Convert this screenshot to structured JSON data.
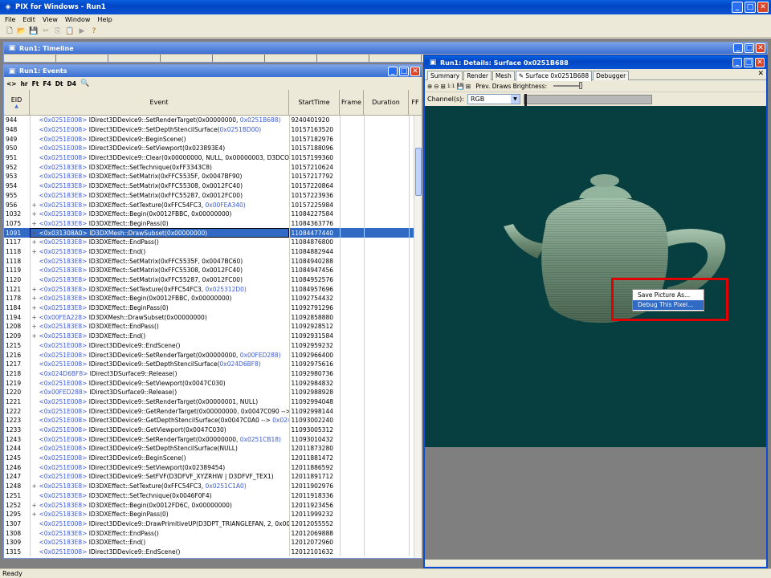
{
  "app": {
    "title": "PIX for Windows - Run1"
  },
  "menu": [
    "File",
    "Edit",
    "View",
    "Window",
    "Help"
  ],
  "timeline": {
    "title": "Run1: Timeline"
  },
  "events": {
    "title": "Run1: Events",
    "toolbar": [
      "hr",
      "Ft",
      "F4",
      "Dt",
      "D4"
    ],
    "columns": [
      "EID",
      "Event",
      "StartTime",
      "Frame",
      "Duration",
      "FF"
    ],
    "rows": [
      {
        "eid": "944",
        "expand": "",
        "addr": "<0x0251E008>",
        "event": " IDirect3DDevice9::SetRenderTarget(0x00000000, ",
        "tail": "0x0251B688)",
        "time": "9240401920"
      },
      {
        "eid": "948",
        "expand": "",
        "addr": "<0x0251E008>",
        "event": " IDirect3DDevice9::SetDepthStencilSurface(",
        "tail": "0x0251BD00)",
        "time": "10157163520"
      },
      {
        "eid": "949",
        "expand": "",
        "addr": "<0x0251E008>",
        "event": " IDirect3DDevice9::BeginScene()",
        "tail": "",
        "time": "10157182976"
      },
      {
        "eid": "950",
        "expand": "",
        "addr": "<0x0251E008>",
        "event": " IDirect3DDevice9::SetViewport(0x023893E4)",
        "tail": "",
        "time": "10157188096"
      },
      {
        "eid": "951",
        "expand": "",
        "addr": "<0x0251E008>",
        "event": " IDirect3DDevice9::Clear(0x00000000, NULL, 0x00000003, D3DCOLOR",
        "tail": "",
        "time": "10157199360"
      },
      {
        "eid": "952",
        "expand": "",
        "addr": "<0x025183E8>",
        "event": " ID3DXEffect::SetTechnique(0xFF3343C8)",
        "tail": "",
        "time": "10157210624"
      },
      {
        "eid": "953",
        "expand": "",
        "addr": "<0x025183E8>",
        "event": " ID3DXEffect::SetMatrix(0xFFC5535F, 0x0047BF90)",
        "tail": "",
        "time": "10157217792"
      },
      {
        "eid": "954",
        "expand": "",
        "addr": "<0x025183E8>",
        "event": " ID3DXEffect::SetMatrix(0xFFC55308, 0x0012FC40)",
        "tail": "",
        "time": "10157220864"
      },
      {
        "eid": "955",
        "expand": "",
        "addr": "<0x025183E8>",
        "event": " ID3DXEffect::SetMatrix(0xFFC55287, 0x0012FC00)",
        "tail": "",
        "time": "10157223936"
      },
      {
        "eid": "956",
        "expand": "+",
        "addr": "<0x025183E8>",
        "event": " ID3DXEffect::SetTexture(0xFFC54FC3, ",
        "tail": "0x00FEA340)",
        "time": "10157225984"
      },
      {
        "eid": "1032",
        "expand": "+",
        "addr": "<0x025183E8>",
        "event": " ID3DXEffect::Begin(0x0012FBBC, 0x00000000)",
        "tail": "",
        "time": "11084227584"
      },
      {
        "eid": "1075",
        "expand": "+",
        "addr": "<0x025183E8>",
        "event": " ID3DXEffect::BeginPass(0)",
        "tail": "",
        "time": "11084363776"
      },
      {
        "eid": "1091",
        "expand": "+",
        "addr": "<0x031308A0>",
        "event": " ID3DXMesh::DrawSubset(0x00000000)",
        "tail": "",
        "time": "11084477440",
        "selected": true
      },
      {
        "eid": "1117",
        "expand": "+",
        "addr": "<0x025183E8>",
        "event": " ID3DXEffect::EndPass()",
        "tail": "",
        "time": "11084876800"
      },
      {
        "eid": "1118",
        "expand": "+",
        "addr": "<0x025183E8>",
        "event": " ID3DXEffect::End()",
        "tail": "",
        "time": "11084882944"
      },
      {
        "eid": "1118",
        "expand": "",
        "addr": "<0x025183E8>",
        "event": " ID3DXEffect::SetMatrix(0xFFC5535F, 0x0047BC60)",
        "tail": "",
        "time": "11084940288"
      },
      {
        "eid": "1119",
        "expand": "",
        "addr": "<0x025183E8>",
        "event": " ID3DXEffect::SetMatrix(0xFFC55308, 0x0012FC40)",
        "tail": "",
        "time": "11084947456"
      },
      {
        "eid": "1120",
        "expand": "",
        "addr": "<0x025183E8>",
        "event": " ID3DXEffect::SetMatrix(0xFFC55287, 0x0012FC00)",
        "tail": "",
        "time": "11084952576"
      },
      {
        "eid": "1121",
        "expand": "+",
        "addr": "<0x025183E8>",
        "event": " ID3DXEffect::SetTexture(0xFFC54FC3, ",
        "tail": "0x025312D0)",
        "time": "11084957696"
      },
      {
        "eid": "1178",
        "expand": "+",
        "addr": "<0x025183E8>",
        "event": " ID3DXEffect::Begin(0x0012FBBC, 0x00000000)",
        "tail": "",
        "time": "11092754432"
      },
      {
        "eid": "1184",
        "expand": "+",
        "addr": "<0x025183E8>",
        "event": " ID3DXEffect::BeginPass(0)",
        "tail": "",
        "time": "11092791296"
      },
      {
        "eid": "1194",
        "expand": "+",
        "addr": "<0x00FEA228>",
        "event": " ID3DXMesh::DrawSubset(0x00000000)",
        "tail": "",
        "time": "11092858880"
      },
      {
        "eid": "1208",
        "expand": "+",
        "addr": "<0x025183E8>",
        "event": " ID3DXEffect::EndPass()",
        "tail": "",
        "time": "11092928512"
      },
      {
        "eid": "1209",
        "expand": "+",
        "addr": "<0x025183E8>",
        "event": " ID3DXEffect::End()",
        "tail": "",
        "time": "11092931584"
      },
      {
        "eid": "1215",
        "expand": "",
        "addr": "<0x0251E008>",
        "event": " IDirect3DDevice9::EndScene()",
        "tail": "",
        "time": "11092959232"
      },
      {
        "eid": "1216",
        "expand": "",
        "addr": "<0x0251E008>",
        "event": " IDirect3DDevice9::SetRenderTarget(0x00000000, ",
        "tail": "0x00FED288)",
        "time": "11092966400"
      },
      {
        "eid": "1217",
        "expand": "",
        "addr": "<0x0251E008>",
        "event": " IDirect3DDevice9::SetDepthStencilSurface(",
        "tail": "0x024D6BF8)",
        "time": "11092975616"
      },
      {
        "eid": "1218",
        "expand": "",
        "addr": "<0x024D6BF8>",
        "event": " IDirect3DSurface9::Release()",
        "tail": "",
        "time": "11092980736"
      },
      {
        "eid": "1219",
        "expand": "",
        "addr": "<0x0251E008>",
        "event": " IDirect3DDevice9::SetViewport(0x0047C030)",
        "tail": "",
        "time": "11092984832"
      },
      {
        "eid": "1220",
        "expand": "",
        "addr": "<0x00FED288>",
        "event": " IDirect3DSurface9::Release()",
        "tail": "",
        "time": "11092988928"
      },
      {
        "eid": "1221",
        "expand": "",
        "addr": "<0x0251E008>",
        "event": " IDirect3DDevice9::SetRenderTarget(0x00000001, NULL)",
        "tail": "",
        "time": "11092994048"
      },
      {
        "eid": "1222",
        "expand": "",
        "addr": "<0x0251E008>",
        "event": " IDirect3DDevice9::GetRenderTarget(0x00000000, 0x0047C090 -->",
        "tail": "",
        "time": "11092998144"
      },
      {
        "eid": "1223",
        "expand": "",
        "addr": "<0x0251E008>",
        "event": " IDirect3DDevice9::GetDepthStencilSurface(0x0047C0A0 --> ",
        "tail": "0x024D",
        "time": "11093002240"
      },
      {
        "eid": "1233",
        "expand": "",
        "addr": "<0x0251E008>",
        "event": " IDirect3DDevice9::GetViewport(0x0047C030)",
        "tail": "",
        "time": "11093005312"
      },
      {
        "eid": "1243",
        "expand": "",
        "addr": "<0x0251E008>",
        "event": " IDirect3DDevice9::SetRenderTarget(0x00000000, ",
        "tail": "0x0251CB18)",
        "time": "11093010432"
      },
      {
        "eid": "1244",
        "expand": "",
        "addr": "<0x0251E008>",
        "event": " IDirect3DDevice9::SetDepthStencilSurface(NULL)",
        "tail": "",
        "time": "12011873280"
      },
      {
        "eid": "1245",
        "expand": "",
        "addr": "<0x0251E008>",
        "event": " IDirect3DDevice9::BeginScene()",
        "tail": "",
        "time": "12011881472"
      },
      {
        "eid": "1246",
        "expand": "",
        "addr": "<0x0251E008>",
        "event": " IDirect3DDevice9::SetViewport(0x02389454)",
        "tail": "",
        "time": "12011886592"
      },
      {
        "eid": "1247",
        "expand": "",
        "addr": "<0x0251E008>",
        "event": " IDirect3DDevice9::SetFVF(D3DFVF_XYZRHW | D3DFVF_TEX1)",
        "tail": "",
        "time": "12011891712"
      },
      {
        "eid": "1248",
        "expand": "+",
        "addr": "<0x025183E8>",
        "event": " ID3DXEffect::SetTexture(0xFFC54FC3, ",
        "tail": "0x0251C1A0)",
        "time": "12011902976"
      },
      {
        "eid": "1251",
        "expand": "",
        "addr": "<0x025183E8>",
        "event": " ID3DXEffect::SetTechnique(0x0046F0F4)",
        "tail": "",
        "time": "12011918336"
      },
      {
        "eid": "1252",
        "expand": "+",
        "addr": "<0x025183E8>",
        "event": " ID3DXEffect::Begin(0x0012FD6C, 0x00000000)",
        "tail": "",
        "time": "12011923456"
      },
      {
        "eid": "1295",
        "expand": "+",
        "addr": "<0x025183E8>",
        "event": " ID3DXEffect::BeginPass(0)",
        "tail": "",
        "time": "12011999232"
      },
      {
        "eid": "1307",
        "expand": "",
        "addr": "<0x0251E008>",
        "event": " IDirect3DDevice9::DrawPrimitiveUP(D3DPT_TRIANGLEFAN, 2, 0x00",
        "tail": "",
        "time": "12012055552"
      },
      {
        "eid": "1308",
        "expand": "",
        "addr": "<0x025183E8>",
        "event": " ID3DXEffect::EndPass()",
        "tail": "",
        "time": "12012069888"
      },
      {
        "eid": "1309",
        "expand": "",
        "addr": "<0x025183E8>",
        "event": " ID3DXEffect::End()",
        "tail": "",
        "time": "12012072960"
      },
      {
        "eid": "1315",
        "expand": "",
        "addr": "<0x0251E008>",
        "event": " IDirect3DDevice9::EndScene()",
        "tail": "",
        "time": "12012101632"
      }
    ]
  },
  "details": {
    "title": "Run1: Details: Surface 0x0251B688",
    "tabs": [
      "Summary",
      "Render",
      "Mesh",
      "Surface 0x0251B688",
      "Debugger"
    ],
    "toolbar": {
      "brightness_label": "Prev. Draws Brightness:"
    },
    "channel": {
      "label": "Channel(s):",
      "value": "RGB"
    },
    "context_menu": [
      "Save Picture As...",
      "Debug This Pixel..."
    ],
    "colors": {
      "viewport": "#073f40",
      "lower": "#7f7f7f",
      "highlight": "#e00000"
    }
  },
  "status": {
    "text": "Ready"
  }
}
